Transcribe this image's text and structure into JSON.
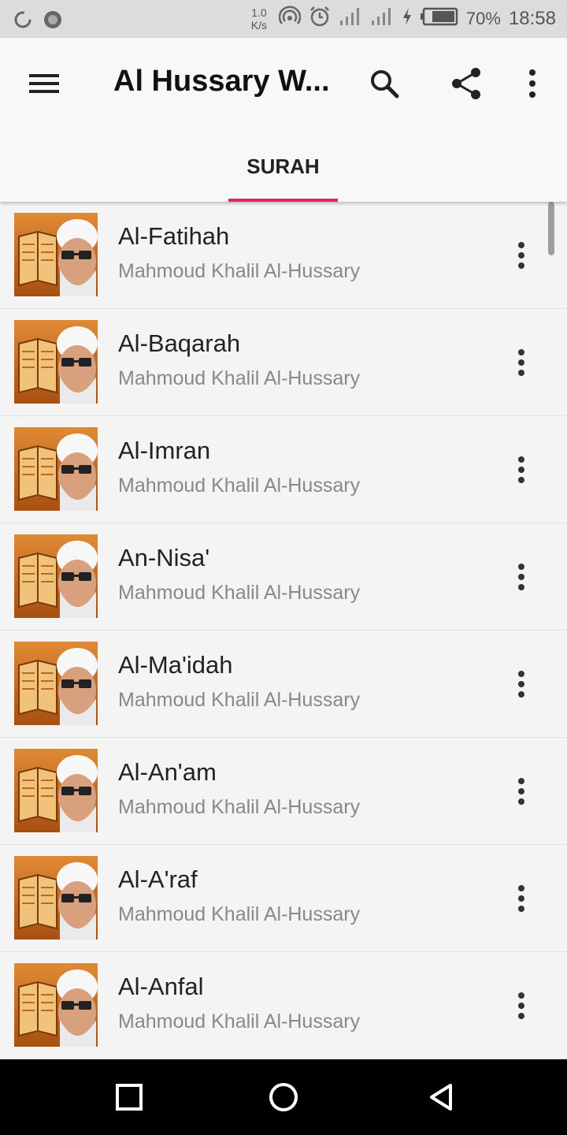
{
  "status_bar": {
    "speed_value": "1.0",
    "speed_unit": "K/s",
    "battery": "70%",
    "time": "18:58"
  },
  "app_bar": {
    "title": "Al Hussary W...",
    "icons": [
      "menu-icon",
      "search-icon",
      "share-icon",
      "more-vert-icon"
    ]
  },
  "tabs": [
    {
      "label": "SURAH",
      "selected": true
    }
  ],
  "list": {
    "items": [
      {
        "name": "Al-Fatihah",
        "reciter": "Mahmoud Khalil Al-Hussary"
      },
      {
        "name": "Al-Baqarah",
        "reciter": "Mahmoud Khalil Al-Hussary"
      },
      {
        "name": "Al-Imran",
        "reciter": "Mahmoud Khalil Al-Hussary"
      },
      {
        "name": "An-Nisa'",
        "reciter": "Mahmoud Khalil Al-Hussary"
      },
      {
        "name": "Al-Ma'idah",
        "reciter": "Mahmoud Khalil Al-Hussary"
      },
      {
        "name": "Al-An'am",
        "reciter": "Mahmoud Khalil Al-Hussary"
      },
      {
        "name": "Al-A'raf",
        "reciter": "Mahmoud Khalil Al-Hussary"
      },
      {
        "name": "Al-Anfal",
        "reciter": "Mahmoud Khalil Al-Hussary"
      }
    ]
  },
  "nav_bar": {
    "icons": [
      "recents-icon",
      "home-icon",
      "back-icon"
    ]
  },
  "colors": {
    "accent": "#e0245e",
    "app_bar": "#f8f8f8",
    "list_bg": "#f4f4f4",
    "thumb_orange": "#c8661a"
  }
}
